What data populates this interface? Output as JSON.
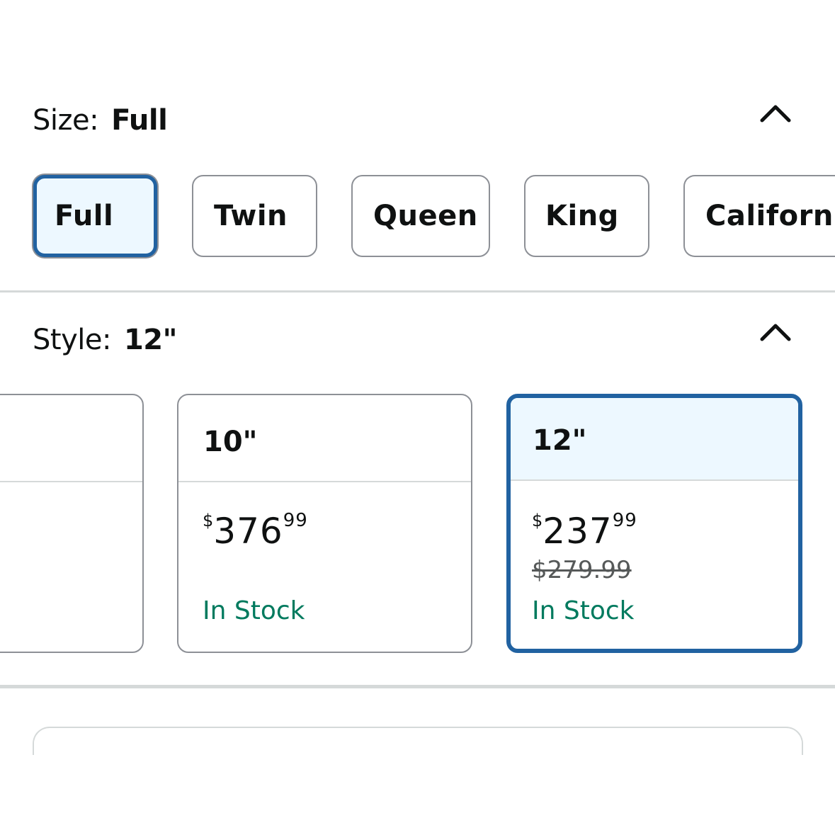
{
  "size": {
    "label": "Size:",
    "selected": "Full",
    "options": [
      "Full",
      "Twin",
      "Queen",
      "King",
      "Californi"
    ]
  },
  "style": {
    "label": "Style:",
    "selected": "12\"",
    "cards": [
      {
        "title": "",
        "price_symbol": "",
        "price_whole": "",
        "price_fraction": "",
        "list_price": "",
        "availability": ""
      },
      {
        "title": "10\"",
        "price_symbol": "$",
        "price_whole": "376",
        "price_fraction": "99",
        "list_price": "",
        "availability": "In Stock"
      },
      {
        "title": "12\"",
        "price_symbol": "$",
        "price_whole": "237",
        "price_fraction": "99",
        "list_price": "$279.99",
        "availability": "In Stock"
      }
    ]
  },
  "icons": {
    "collapse": "chevron-up-icon"
  },
  "colors": {
    "selected_border": "#2162a1",
    "selected_bg": "#edf8ff",
    "in_stock": "#007a5e",
    "unselected_border": "#8d9096",
    "divider": "#d5d9d9"
  }
}
